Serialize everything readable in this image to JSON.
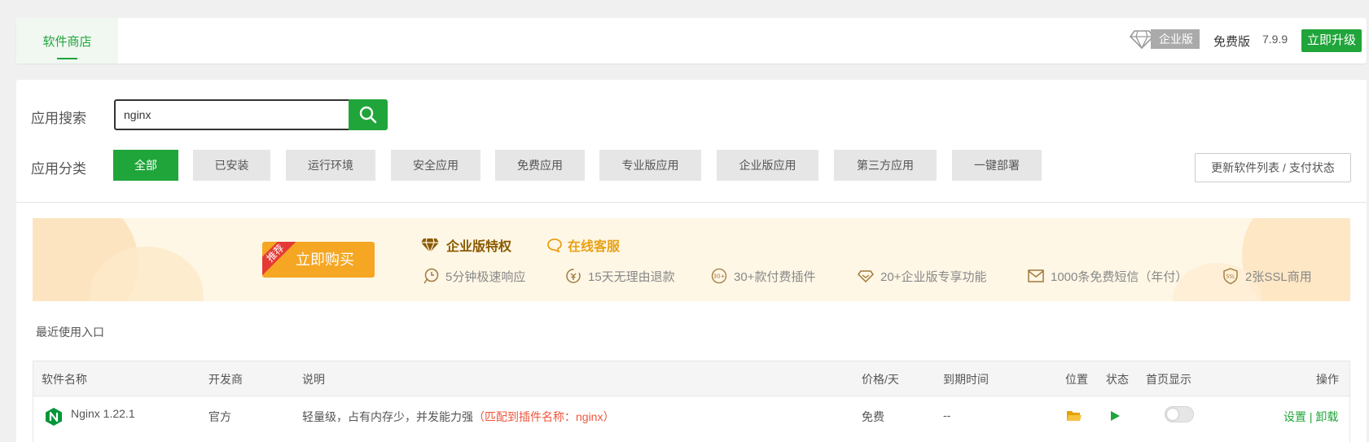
{
  "header": {
    "tab_store": "软件商店",
    "enterprise_label": "企业版",
    "free_label": "免费版",
    "version": "7.9.9",
    "upgrade_label": "立即升级"
  },
  "search": {
    "label": "应用搜索",
    "value": "nginx",
    "placeholder": ""
  },
  "category": {
    "label": "应用分类",
    "items": [
      "全部",
      "已安装",
      "运行环境",
      "安全应用",
      "免费应用",
      "专业版应用",
      "企业版应用",
      "第三方应用",
      "一键部署"
    ],
    "active": "全部"
  },
  "refresh_label": "更新软件列表 / 支付状态",
  "banner": {
    "badge": "推荐",
    "buy_label": "立即购买",
    "privilege_title": "企业版特权",
    "online_service": "在线客服",
    "features": [
      "5分钟极速响应",
      "15天无理由退款",
      "30+款付费插件",
      "20+企业版专享功能",
      "1000条免费短信（年付）",
      "2张SSL商用"
    ],
    "badge_30": "30+",
    "badge_ssl": "SSL"
  },
  "recent_label": "最近使用入口",
  "table": {
    "headers": {
      "name": "软件名称",
      "dev": "开发商",
      "desc": "说明",
      "price": "价格/天",
      "expire": "到期时间",
      "position": "位置",
      "status": "状态",
      "home": "首页显示",
      "actions": "操作"
    },
    "row": {
      "name": "Nginx 1.22.1",
      "dev": "官方",
      "desc": "轻量级，占有内存少，并发能力强",
      "match": "（匹配到插件名称：nginx）",
      "price": "免费",
      "expire": "--",
      "action_settings": "设置",
      "action_sep": "|",
      "action_uninstall": "卸载"
    }
  },
  "colors": {
    "brand_green": "#20a53a",
    "banner_orange": "#f5a623",
    "match_red": "#f0553c"
  }
}
